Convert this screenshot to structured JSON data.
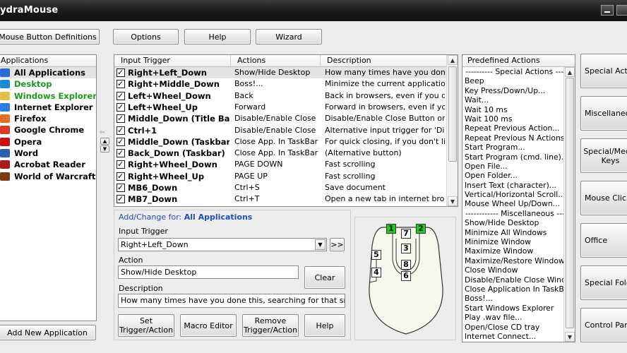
{
  "window": {
    "title": "ydraMouse"
  },
  "toolbar": {
    "mouse_button_definitions": "Mouse Button Definitions",
    "options": "Options",
    "help": "Help",
    "wizard": "Wizard"
  },
  "applications": {
    "header": "Applications",
    "items": [
      {
        "label": "All Applications",
        "color": "#000000",
        "icon": "all-apps-icon",
        "icon_color": "#2a6bd6"
      },
      {
        "label": "Desktop",
        "color": "#1a9a1a",
        "icon": "desktop-icon",
        "icon_color": "#1a8bd6"
      },
      {
        "label": "Windows Explorer",
        "color": "#1a9a1a",
        "icon": "folder-icon",
        "icon_color": "#e5c04a"
      },
      {
        "label": "Internet Explorer",
        "color": "#000000",
        "icon": "ie-icon",
        "icon_color": "#2d7ee0"
      },
      {
        "label": "Firefox",
        "color": "#000000",
        "icon": "firefox-icon",
        "icon_color": "#e3701e"
      },
      {
        "label": "Google Chrome",
        "color": "#000000",
        "icon": "chrome-icon",
        "icon_color": "#d9382c"
      },
      {
        "label": "Opera",
        "color": "#000000",
        "icon": "opera-icon",
        "icon_color": "#cc1111"
      },
      {
        "label": "Word",
        "color": "#000000",
        "icon": "word-icon",
        "icon_color": "#2d5fb0"
      },
      {
        "label": "Acrobat Reader",
        "color": "#000000",
        "icon": "acrobat-icon",
        "icon_color": "#b01818"
      },
      {
        "label": "World of Warcraft",
        "color": "#000000",
        "icon": "wow-icon",
        "icon_color": "#7a3b10"
      }
    ],
    "add_new": "Add New Application"
  },
  "triggers": {
    "headers": [
      "Input Trigger",
      "Actions",
      "Description"
    ],
    "rows": [
      {
        "trigger": "Right+Left_Down",
        "action": "Show/Hide Desktop",
        "desc": "How many times have you done t..."
      },
      {
        "trigger": "Right+Middle_Down",
        "action": "Boss!...",
        "desc": "Minimize the current application a..."
      },
      {
        "trigger": "Left+Wheel_Down",
        "action": "Back",
        "desc": "Back in browsers, even if you don..."
      },
      {
        "trigger": "Left+Wheel_Up",
        "action": "Forward",
        "desc": "Forward in browsers, even if you d..."
      },
      {
        "trigger": "Middle_Down (Title Bar)",
        "action": "Disable/Enable Close",
        "desc": "Disable/Enable Close Button on a..."
      },
      {
        "trigger": "Ctrl+1",
        "action": "Disable/Enable Close",
        "desc": "Alternative input trigger for 'Disabl..."
      },
      {
        "trigger": "Middle_Down (Taskbar)",
        "action": "Close App. In TaskBar",
        "desc": "For quick closing, if you don't like ..."
      },
      {
        "trigger": "Back_Down (Taskbar)",
        "action": "Close App. In TaskBar",
        "desc": "(Alternative button)"
      },
      {
        "trigger": "Right+Wheel_Down",
        "action": "PAGE DOWN",
        "desc": "Fast scrolling"
      },
      {
        "trigger": "Right+Wheel_Up",
        "action": "PAGE UP",
        "desc": "Fast scrolling"
      },
      {
        "trigger": "MB6_Down",
        "action": "Ctrl+S",
        "desc": "Save document"
      },
      {
        "trigger": "MB7_Down",
        "action": "Ctrl+T",
        "desc": "Open a new tab in internet browsers"
      }
    ]
  },
  "edit": {
    "heading_prefix": "Add/Change for:",
    "heading_app": "All  Applications",
    "input_trigger_label": "Input Trigger",
    "input_trigger_value": "Right+Left_Down",
    "more_button": ">>",
    "action_label": "Action",
    "action_value": "Show/Hide Desktop",
    "clear": "Clear",
    "description_label": "Description",
    "description_value": "How many times have you done this, searching for that small \"Show D",
    "set_trigger": "Set Trigger/Action",
    "macro_editor": "Macro Editor",
    "remove_trigger": "Remove Trigger/Action",
    "help": "Help"
  },
  "mouse": {
    "buttons": [
      "1",
      "2",
      "7",
      "3",
      "8",
      "6",
      "5",
      "4"
    ]
  },
  "predefined": {
    "header": "Predefined Actions",
    "items": [
      "---------- Special Actions ----------",
      "Beep",
      "Key Press/Down/Up...",
      "Wait...",
      "Wait 10 ms",
      "Wait 100 ms",
      "Repeat Previous Action...",
      "Repeat Previous N Actions...",
      "Start Program...",
      "Start Program (cmd. line)...",
      "Open File...",
      "Open Folder...",
      "Insert Text (character)...",
      "Vertical/Horizontal Scroll...",
      "Mouse Wheel Up/Down...",
      "------------ Miscellaneous ------------",
      "Show/Hide Desktop",
      "Minimize All Windows",
      "Minimize Window",
      "Maximize Window",
      "Maximize/Restore Window",
      "Close Window",
      "Disable/Enable Close Window",
      "Close Application In TaskBar",
      "Boss!...",
      "Start Windows Explorer",
      "Play .wav file...",
      "Open/Close CD tray",
      "Internet Connect..."
    ]
  },
  "categories": [
    "Special Actions",
    "Miscellaneous",
    "Special/Media Keys",
    "Mouse Clicks",
    "Office",
    "Special Folders",
    "Control Panel"
  ]
}
